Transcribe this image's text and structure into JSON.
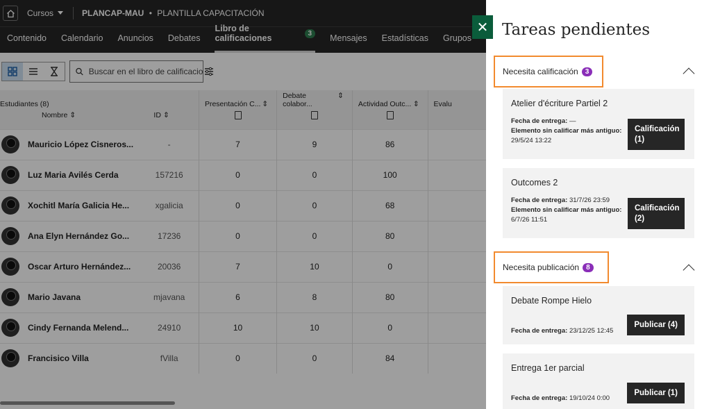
{
  "topbar": {
    "courses_label": "Cursos",
    "course_code": "PLANCAP-MAU",
    "course_separator": "•",
    "course_title": "PLANTILLA CAPACITACIÓN"
  },
  "nav": {
    "items": [
      "Contenido",
      "Calendario",
      "Anuncios",
      "Debates",
      "Libro de calificaciones",
      "Mensajes",
      "Estadísticas",
      "Grupos"
    ],
    "active_badge": "3"
  },
  "toolbar": {
    "search_placeholder": "Buscar en el libro de calificaciones"
  },
  "grid": {
    "students_header": "Estudiantes (8)",
    "name_header": "Nombre",
    "id_header": "ID",
    "columns": [
      "Presentación C...",
      "Debate colabor...",
      "Actividad Outc...",
      "Evalu"
    ],
    "rows": [
      {
        "name": "Mauricio López Cisneros...",
        "id": "-",
        "s1": "7",
        "s2": "9",
        "s3": "86"
      },
      {
        "name": "Luz Maria Avilés Cerda",
        "id": "157216",
        "s1": "0",
        "s2": "0",
        "s3": "100"
      },
      {
        "name": "Xochitl María Galicia He...",
        "id": "xgalicia",
        "s1": "0",
        "s2": "0",
        "s3": "68"
      },
      {
        "name": "Ana Elyn Hernández Go...",
        "id": "17236",
        "s1": "0",
        "s2": "0",
        "s3": "80"
      },
      {
        "name": "Oscar Arturo Hernández...",
        "id": "20036",
        "s1": "7",
        "s2": "10",
        "s3": "0"
      },
      {
        "name": "Mario Javana",
        "id": "mjavana",
        "s1": "6",
        "s2": "8",
        "s3": "80"
      },
      {
        "name": "Cindy Fernanda Melend...",
        "id": "24910",
        "s1": "10",
        "s2": "10",
        "s3": "0"
      },
      {
        "name": "Francisico Villa",
        "id": "fVilla",
        "s1": "0",
        "s2": "0",
        "s3": "84"
      }
    ]
  },
  "panel": {
    "close_glyph": "✕",
    "title": "Tareas pendientes",
    "grading": {
      "label": "Necesita calificación",
      "count": "3",
      "items": [
        {
          "title": "Atelier d'écriture Partiel 2",
          "due_label": "Fecha de entrega:",
          "due": "—",
          "oldest_label": "Elemento sin calificar más antiguo:",
          "oldest": "29/5/24 13:22",
          "button": "Calificación (1)"
        },
        {
          "title": "Outcomes 2",
          "due_label": "Fecha de entrega:",
          "due": "31/7/26 23:59",
          "oldest_label": "Elemento sin calificar más antiguo:",
          "oldest": "6/7/26 11:51",
          "button": "Calificación (2)"
        }
      ]
    },
    "posting": {
      "label": "Necesita publicación",
      "count": "8",
      "items": [
        {
          "title": "Debate Rompe Hielo",
          "due_label": "Fecha de entrega:",
          "due": "23/12/25 12:45",
          "button": "Publicar (4)"
        },
        {
          "title": "Entrega 1er parcial",
          "due_label": "Fecha de entrega:",
          "due": "19/10/24 0:00",
          "button": "Publicar (1)"
        }
      ]
    }
  },
  "colors": {
    "accent_green": "#0a5c3b",
    "highlight_orange": "#f28a2e",
    "badge_purple": "#8a2eb8",
    "dark": "#262626"
  }
}
